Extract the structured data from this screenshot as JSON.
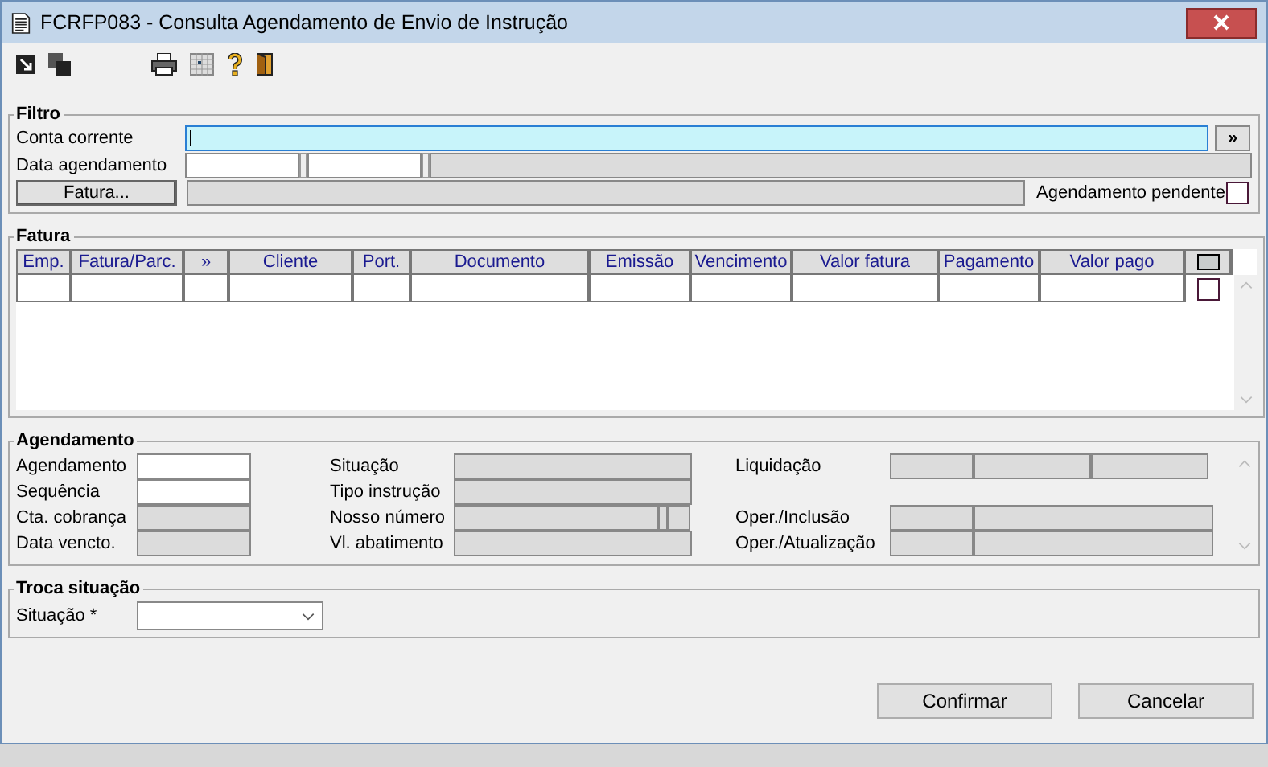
{
  "window": {
    "title": "FCRFP083 - Consulta Agendamento de Envio de Instrução"
  },
  "filtro": {
    "title": "Filtro",
    "conta_label": "Conta corrente",
    "lookup_button": "»",
    "data_label": "Data agendamento",
    "fatura_button": "Fatura...",
    "pendente": {
      "label": "Agendamento pendente",
      "checked": false
    }
  },
  "fatura": {
    "title": "Fatura",
    "columns": [
      "Emp.",
      "Fatura/Parc.",
      "»",
      "Cliente",
      "Port.",
      "Documento",
      "Emissão",
      "Vencimento",
      "Valor fatura",
      "Pagamento",
      "Valor pago"
    ],
    "row_checked": false
  },
  "agendamento": {
    "title": "Agendamento",
    "left": [
      {
        "label": "Agendamento",
        "kind": "input"
      },
      {
        "label": "Sequência",
        "kind": "input"
      },
      {
        "label": "Cta. cobrança",
        "kind": "readonly"
      },
      {
        "label": "Data vencto.",
        "kind": "readonly"
      }
    ],
    "middle": [
      {
        "label": "Situação"
      },
      {
        "label": "Tipo instrução"
      },
      {
        "label": "Nosso número"
      },
      {
        "label": "Vl. abatimento"
      }
    ],
    "right": [
      {
        "label": "Liquidação"
      },
      {
        "label": "Oper./Inclusão"
      },
      {
        "label": "Oper./Atualização"
      }
    ]
  },
  "troca": {
    "title": "Troca situação",
    "situacao_label": "Situação *"
  },
  "buttons": [
    "Confirmar",
    "Cancelar"
  ]
}
